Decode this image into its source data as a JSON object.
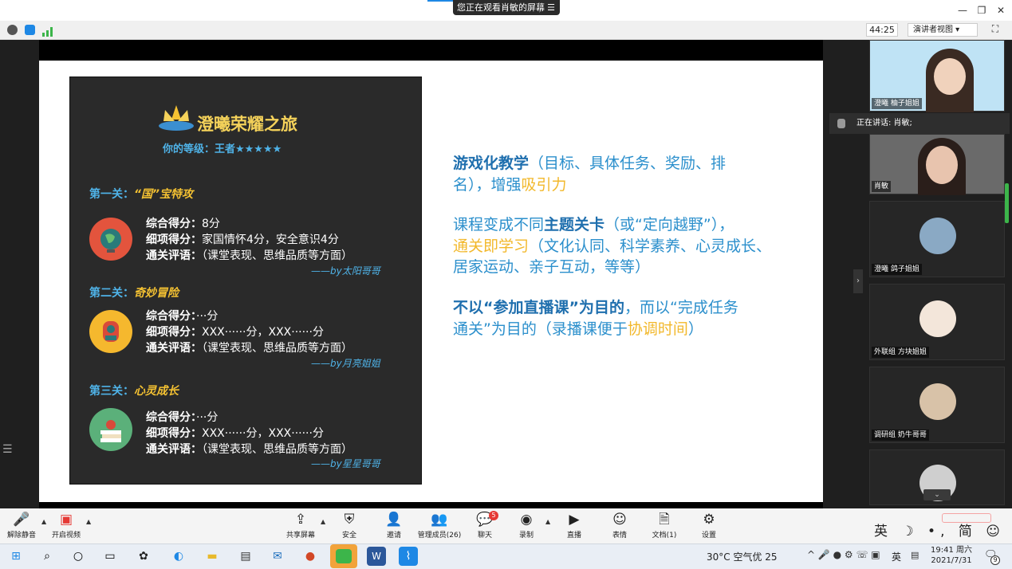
{
  "window": {
    "share_banner": "您正在观看肖敏的屏幕",
    "timer": "44:25",
    "view_mode": "演讲者视图"
  },
  "slide": {
    "panel": {
      "title": "澄曦荣耀之旅",
      "level": "你的等级：王者★★★★★",
      "stages": [
        {
          "prefix": "第一关：",
          "name": "“国”宝特攻",
          "score_label": "综合得分：",
          "score": "8分",
          "detail_label": "细项得分：",
          "detail": "家国情怀4分，安全意识4分",
          "comment_label": "通关评语：",
          "comment": "（课堂表现、思维品质等方面）",
          "by": "——by太阳哥哥"
        },
        {
          "prefix": "第二关：",
          "name": "奇妙冒险",
          "score_label": "综合得分：",
          "score": "···分",
          "detail_label": "细项得分：",
          "detail": "XXX······分，XXX······分",
          "comment_label": "通关评语：",
          "comment": "（课堂表现、思维品质等方面）",
          "by": "——by月亮姐姐"
        },
        {
          "prefix": "第三关：",
          "name": "心灵成长",
          "score_label": "综合得分：",
          "score": "···分",
          "detail_label": "细项得分：",
          "detail": "XXX······分，XXX······分",
          "comment_label": "通关评语：",
          "comment": "（课堂表现、思维品质等方面）",
          "by": "——by星星哥哥"
        }
      ]
    },
    "right": {
      "p1_bold": "游戏化教学",
      "p1_rest": "（目标、具体任务、奖励、排",
      "p1_line2_a": "名），增强",
      "p1_line2_b": "吸引力",
      "p2_a": "课程变成不同",
      "p2_b": "主题关卡",
      "p2_c": "（或“定向越野”），",
      "p2_line2_a": "通关即学习",
      "p2_line2_b": "（文化认同、科学素养、心灵成长、",
      "p2_line3": "居家运动、亲子互动，等等）",
      "p3_bold": "不以“参加直播课”为目的",
      "p3_rest": "，而以“完成任务",
      "p3_line2_a": "通关”为目的（录播课便于",
      "p3_line2_b": "协调时间",
      "p3_line2_c": "）"
    }
  },
  "participants": {
    "speaking": "正在讲话: 肖敏;",
    "tiles": [
      {
        "label": "澄曦 柚子姐姐"
      },
      {
        "label": "肖敏"
      },
      {
        "label": "澄曦 鸽子姐姐"
      },
      {
        "label": "外联组 方块姐姐"
      },
      {
        "label": "调研组 奶牛哥哥"
      }
    ]
  },
  "controls": {
    "unmute": "解除静音",
    "video": "开启视频",
    "share": "共享屏幕",
    "security": "安全",
    "invite": "邀请",
    "members": "管理成员(26)",
    "chat": "聊天",
    "chat_badge": "5",
    "record": "录制",
    "live": "直播",
    "reactions": "表情",
    "docs": "文档(1)",
    "settings": "设置",
    "ime": "英 ☽ •, 简 ☺ ⚙"
  },
  "taskbar": {
    "weather": "30°C  空气优 25",
    "lang": "英",
    "time": "19:41 周六",
    "date": "2021/7/31",
    "notif_count": "9"
  },
  "colors": {
    "slide_blue": "#2b8fcc",
    "slide_yellow": "#f2b82b",
    "panel_bg": "#2a2a2a"
  }
}
